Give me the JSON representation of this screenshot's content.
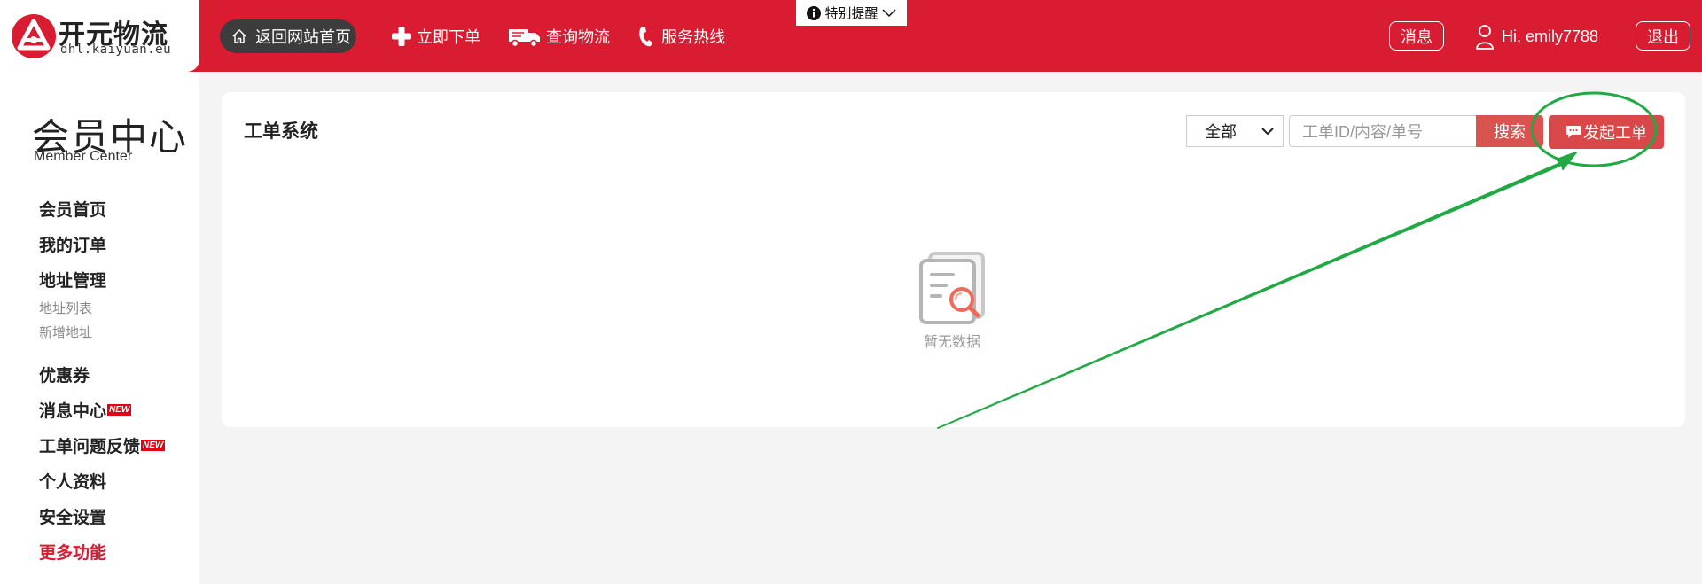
{
  "brand": {
    "name_cn": "开元物流",
    "domain": "dhl.kaiyuan.eu",
    "color": "#d91c31"
  },
  "header": {
    "home_link": "返回网站首页",
    "nav": [
      {
        "label": "立即下单",
        "icon": "plus-icon"
      },
      {
        "label": "查询物流",
        "icon": "truck-icon"
      },
      {
        "label": "服务热线",
        "icon": "phone-icon"
      }
    ],
    "notice": "特别提醒",
    "messages_label": "消息",
    "greeting": "Hi, emily7788",
    "logout_label": "退出"
  },
  "sidebar": {
    "title": "会员中心",
    "subtitle": "Member Center",
    "items": [
      {
        "label": "会员首页"
      },
      {
        "label": "我的订单"
      },
      {
        "label": "地址管理"
      },
      {
        "label": "地址列表"
      },
      {
        "label": "新增地址"
      },
      {
        "label": "优惠券"
      },
      {
        "label": "消息中心",
        "badge": "NEW"
      },
      {
        "label": "工单问题反馈",
        "badge": "NEW"
      },
      {
        "label": "个人资料"
      },
      {
        "label": "安全设置"
      },
      {
        "label": "更多功能"
      }
    ]
  },
  "main": {
    "title": "工单系统",
    "filter_value": "全部",
    "search_placeholder": "工单ID/内容/单号",
    "search_button": "搜索",
    "create_button": "发起工单",
    "empty_text": "暂无数据"
  },
  "annotation_color": "#22a845"
}
